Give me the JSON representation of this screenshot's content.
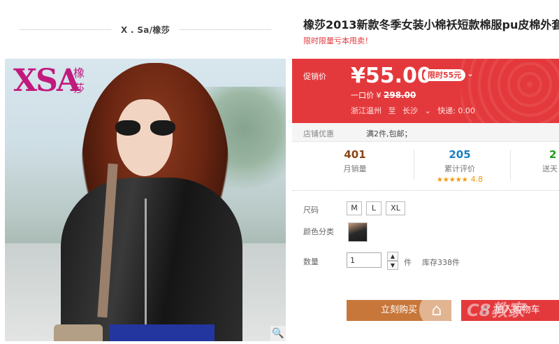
{
  "store": {
    "name": "X . Sa/橡莎"
  },
  "brand_logo": {
    "latin": "XSA",
    "chinese": "橡莎"
  },
  "product": {
    "title": "橡莎2013新款冬季女装小棉袄短款棉服pu皮棉外套",
    "subtitle": "限时限量亏本甩卖！"
  },
  "promo": {
    "label": "促销价",
    "price": "¥55.00",
    "limit_badge": "限时55元",
    "original_label": "一口价 ¥ ",
    "original_price": "298.00",
    "ship_from": "浙江温州",
    "ship_to_word": "至",
    "ship_to": "长沙",
    "delivery": "快递: 0.00"
  },
  "discount": {
    "label": "店铺优惠",
    "text": "满2件,包邮；"
  },
  "stats": {
    "monthly_sales": {
      "value": "401",
      "label": "月销量",
      "color": "#8b4513"
    },
    "reviews": {
      "value": "205",
      "label": "累计评价",
      "stars": "★★★★★",
      "score": "4.8",
      "color": "#1a7fbf"
    },
    "third": {
      "value": "2",
      "label": "送天",
      "color": "#1a9e1a"
    }
  },
  "options": {
    "size_label": "尺码",
    "sizes": [
      "M",
      "L",
      "XL"
    ],
    "color_label": "颜色分类",
    "qty_label": "数量",
    "qty_value": "1",
    "qty_unit": "件",
    "stock": "库存338件"
  },
  "buttons": {
    "buy": "立刻购买",
    "cart": "加入购物车"
  },
  "watermark": {
    "text": "C8教家"
  },
  "icons": {
    "zoom": "magnifier-icon",
    "cart": "cart-icon",
    "home": "house-icon",
    "dropdown": "chevron-down-icon"
  }
}
